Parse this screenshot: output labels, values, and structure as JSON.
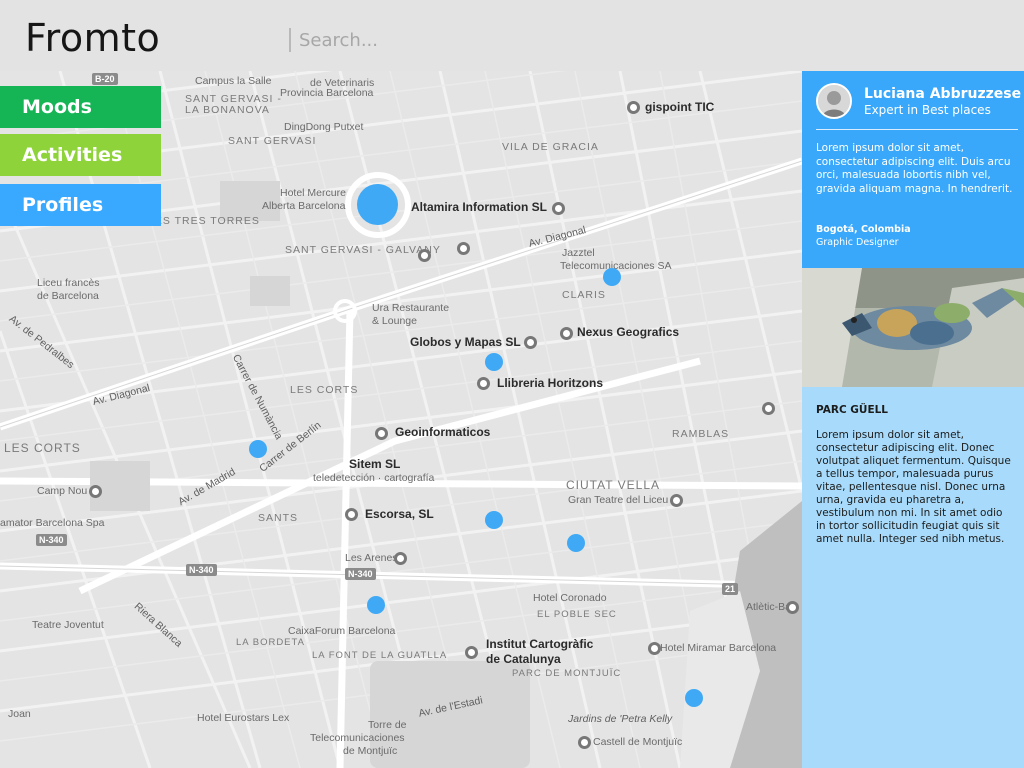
{
  "header": {
    "logo": "Fromto",
    "search_placeholder": "Search..."
  },
  "filters": {
    "moods": "Moods",
    "activities": "Activities",
    "profiles": "Profiles"
  },
  "colors": {
    "moods": "#15b556",
    "activities": "#8fd33a",
    "profiles": "#39a8ff",
    "profile_card": "#3aa8fa",
    "place_card": "#a8dbfb",
    "marker": "#3fa9f5"
  },
  "map": {
    "labels": {
      "campus_la_salle": "Campus la Salle",
      "veterinaris": "de Veterinaris",
      "provincia": "Provincia Barcelona",
      "sant_gervasi_bonanova": "SANT GERVASI -",
      "la_bonanova": "LA BONANOVA",
      "dingdong": "DingDong Putxet",
      "sant_gervasi": "SANT GERVASI",
      "gispoint": "gispoint TIC",
      "vila_de_gracia": "VILA DE GRACIA",
      "hotel_mercure": "Hotel Mercure",
      "alberta": "Alberta Barcelona",
      "altamira": "Altamira Information SL",
      "tres_torres": "LES TRES TORRES",
      "sant_gervasi_galvany": "SANT GERVASI - GALVANY",
      "av_diagonal_1": "Av. Diagonal",
      "jazztel": "Jazztel",
      "jazztel_2": "Telecomunicaciones SA",
      "liceu": "Liceu francès",
      "liceu_2": "de Barcelona",
      "ura": "Ura Restaurante",
      "ura_2": "& Lounge",
      "claris": "CLARIS",
      "av_pedralbes": "Av. de Pedralbes",
      "globos": "Globos y Mapas SL",
      "nexus": "Nexus Geografics",
      "llibreria": "Llibreria Horitzons",
      "av_diagonal_2": "Av. Diagonal",
      "les_corts_area": "LES CORTS",
      "carrer_numancia": "Carrer de Numància",
      "carrer_berlin": "Carrer de Berlín",
      "geoinformaticos": "Geoinformaticos",
      "ramblas": "RAMBLAS",
      "les_corts": "LES CORTS",
      "sitem": "Sitem SL",
      "sitem_2": "teledetección · cartografía",
      "camp_nou": "Camp Nou",
      "av_madrid": "Av. de Madrid",
      "ciutat_vella": "CIUTAT VELLA",
      "gran_teatre": "Gran Teatre del Liceu",
      "sants": "SANTS",
      "escorsa": "Escorsa, SL",
      "amator": "amator Barcelona Spa",
      "les_arenes": "Les Arenes",
      "hotel_coronado": "Hotel Coronado",
      "el_poble_sec": "EL POBLE SEC",
      "teatre_joventut": "Teatre Joventut",
      "riera_blanca": "Riera Blanca",
      "caixaforum": "CaixaForum Barcelona",
      "la_bordeta": "LA BORDETA",
      "la_font": "LA FONT DE LA GUATLLA",
      "institut": "Institut Cartogràfic",
      "institut_2": "de Catalunya",
      "parc_montjuic": "PARC DE MONTJUÏC",
      "hotel_miramar": "Hotel Miramar Barcelona",
      "atletic": "Atlètic-Bar",
      "hotel_eurostars": "Hotel Eurostars Lex",
      "torre_1": "Torre de",
      "torre_2": "Telecomunicaciones",
      "torre_3": "de Montjuïc",
      "jardins": "Jardins de 'Petra Kelly",
      "castell": "Castell de Montjuïc",
      "av_estadi": "Av. de l'Estadi",
      "sant_joan": "Joan"
    },
    "shields": {
      "b20": "B-20",
      "n340_a": "N-340",
      "n340_b": "N-340",
      "n340_c": "N-340",
      "r21": "21"
    }
  },
  "profile": {
    "name": "Luciana Abbruzzese",
    "role": "Expert in Best places",
    "bio": "Lorem ipsum dolor sit amet, consectetur adipiscing elit. Duis arcu orci, malesuada lobortis nibh vel, gravida aliquam magna. In hendrerit.",
    "location": "Bogotá, Colombia",
    "job": "Graphic Designer"
  },
  "place": {
    "title": "PARC GÜELL",
    "description": "Lorem ipsum dolor sit amet, consectetur adipiscing elit. Donec volutpat aliquet fermentum. Quisque a tellus tempor, malesuada purus vitae, pellentesque nisl. Donec urna urna, gravida eu pharetra a, vestibulum non mi. In sit amet odio in tortor sollicitudin feugiat quis sit amet nulla. Integer sed nibh metus."
  }
}
